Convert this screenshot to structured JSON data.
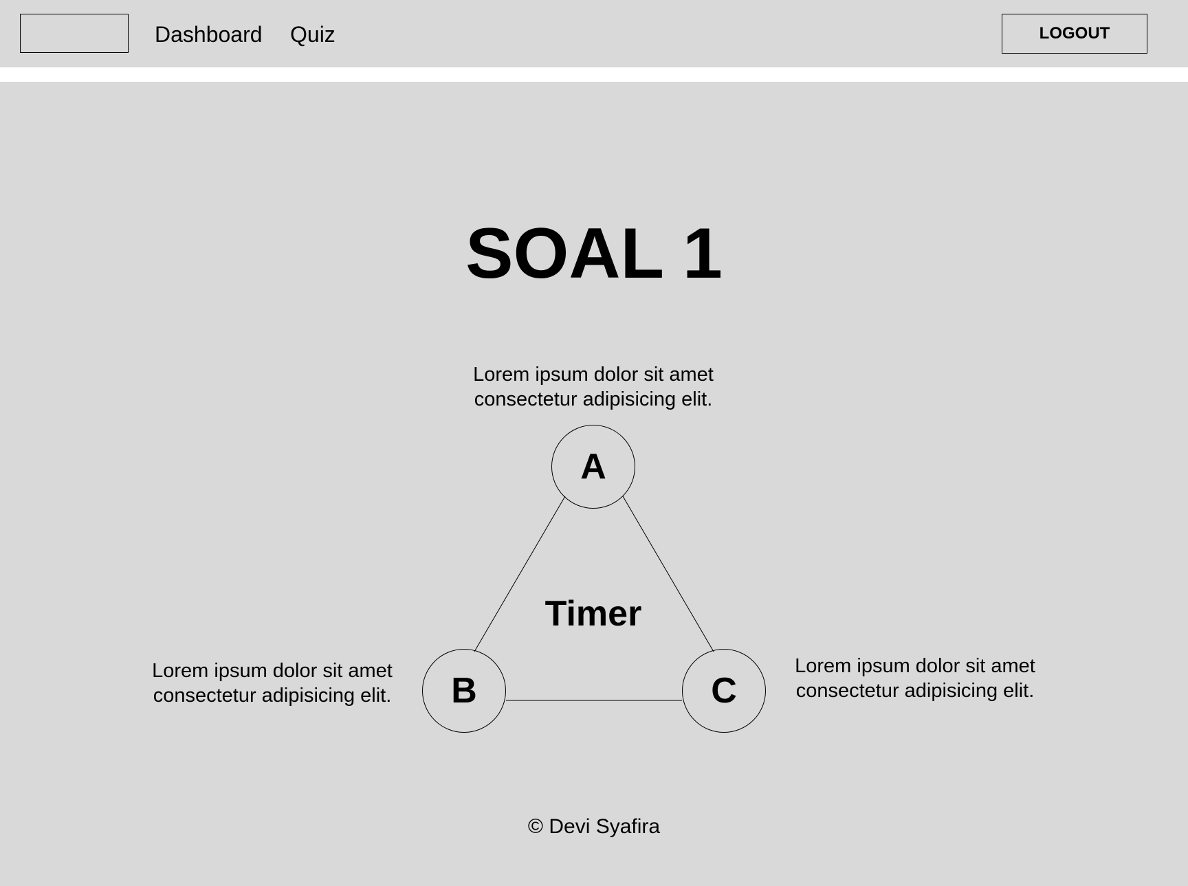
{
  "nav": {
    "links": [
      "Dashboard",
      "Quiz"
    ],
    "logout_label": "LOGOUT"
  },
  "quiz": {
    "title": "SOAL 1",
    "timer_label": "Timer",
    "options": [
      {
        "letter": "A",
        "text": "Lorem ipsum dolor sit amet consectetur adipisicing elit."
      },
      {
        "letter": "B",
        "text": "Lorem ipsum dolor sit amet consectetur adipisicing elit."
      },
      {
        "letter": "C",
        "text": "Lorem ipsum dolor sit amet consectetur adipisicing elit."
      }
    ]
  },
  "footer": {
    "copyright": "© Devi Syafira"
  },
  "colors": {
    "background": "#d9d9d9",
    "separator": "#ffffff",
    "text": "#000000"
  }
}
